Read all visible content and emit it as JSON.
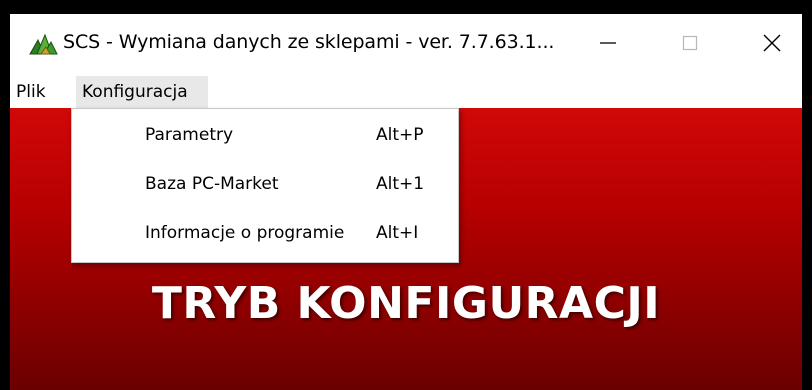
{
  "window": {
    "title": "SCS - Wymiana danych ze sklepami  -  ver. 7.7.63.1...",
    "icon": "scs-app-icon",
    "controls": {
      "minimize": "minimize-icon",
      "maximize": "maximize-icon",
      "close": "close-icon"
    }
  },
  "menubar": {
    "items": [
      {
        "label": "Plik"
      },
      {
        "label": "Konfiguracja"
      }
    ]
  },
  "dropdown": {
    "items": [
      {
        "label": "Parametry",
        "shortcut": "Alt+P"
      },
      {
        "label": "Baza PC-Market",
        "shortcut": "Alt+1"
      },
      {
        "label": "Informacje o programie",
        "shortcut": "Alt+I"
      }
    ]
  },
  "main": {
    "banner": "TRYB KONFIGURACJI"
  },
  "colors": {
    "banner_bg_top": "#d00808",
    "banner_bg_bottom": "#6a0000",
    "banner_text": "#ffffff",
    "menu_hover": "#e8e8e8",
    "app_icon_green": "#3c9a2c"
  }
}
